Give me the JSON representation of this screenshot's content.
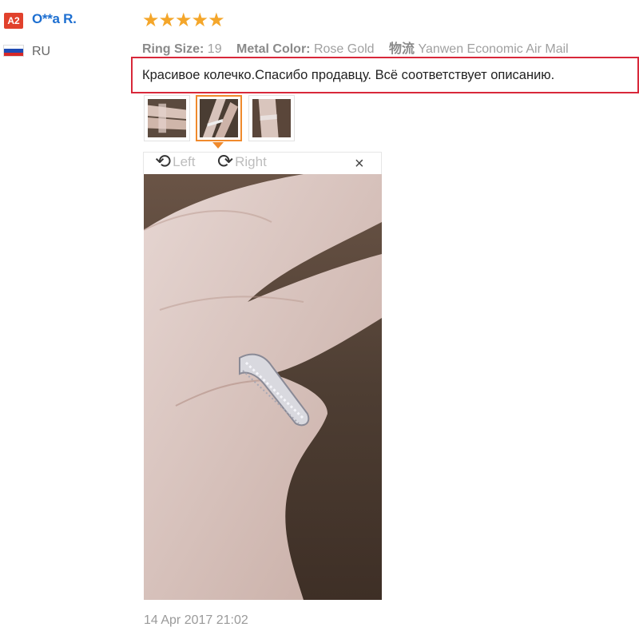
{
  "user": {
    "level_badge": "A2",
    "name": "O**a R.",
    "country": "RU",
    "flag_colors": [
      "#ffffff",
      "#1f4bb4",
      "#d62828"
    ]
  },
  "review": {
    "stars": "★★★★★",
    "rating": 5,
    "attributes": [
      {
        "label": "Ring Size:",
        "value": "19"
      },
      {
        "label": "Metal Color:",
        "value": "Rose Gold"
      },
      {
        "label": "物流",
        "value": "Yanwen Economic Air Mail"
      }
    ],
    "text": "Красивое колечко.Спасибо продавцу. Всё соответствует описанию.",
    "date": "14 Apr 2017 21:02"
  },
  "viewer": {
    "rotate_left_label": "Left",
    "rotate_right_label": "Right",
    "close_symbol": "×",
    "thumbnail_count": 3,
    "active_thumbnail": 2
  },
  "colors": {
    "accent_orange": "#f08a2c",
    "highlight_red": "#d8283a",
    "link_blue": "#1d6fd1",
    "star_gold": "#f4a62a"
  }
}
